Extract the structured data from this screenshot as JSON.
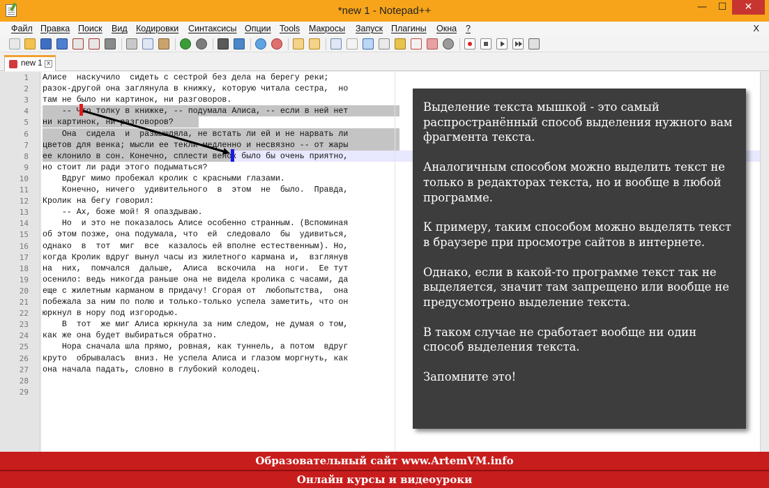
{
  "window": {
    "title": "*new 1 - Notepad++",
    "min_label": "—",
    "max_label": "☐",
    "close_label": "✕"
  },
  "menu": {
    "items": [
      "Файл",
      "Правка",
      "Поиск",
      "Вид",
      "Кодировки",
      "Синтаксисы",
      "Опции",
      "Tools",
      "Макросы",
      "Запуск",
      "Плагины",
      "Окна",
      "?"
    ],
    "close_label": "X"
  },
  "toolbar": {
    "buttons": [
      "new-file-icon",
      "open-file-icon",
      "save-icon",
      "save-all-icon",
      "close-icon",
      "close-all-icon",
      "print-icon",
      "cut-icon",
      "copy-icon",
      "paste-icon",
      "undo-icon",
      "redo-icon",
      "find-icon",
      "replace-icon",
      "zoom-in-icon",
      "zoom-out-icon",
      "sync-v-icon",
      "sync-h-icon",
      "word-wrap-icon",
      "show-all-chars-icon",
      "indent-guide-icon",
      "language-icon",
      "doc-map-icon",
      "function-list-icon",
      "folder-workspace-icon",
      "monitor-icon",
      "record-macro-icon",
      "stop-record-icon",
      "play-macro-icon",
      "run-macro-icon",
      "save-macro-icon"
    ]
  },
  "tab": {
    "name": "new 1",
    "close_label": "x"
  },
  "editor": {
    "lines": [
      "Алисе  наскучило  сидеть с сестрой без дела на берегу реки;",
      "разок-другой она заглянула в книжку, которую читала сестра,  но",
      "там не было ни картинок, ни разговоров.",
      "    -- Что толку в книжке, -- подумала Алиса, -- если в ней нет",
      "ни картинок, ни разговоров?",
      "    Она  сидела  и  размышляла, не встать ли ей и не нарвать ли",
      "цветов для венка; мысли ее текли медленно и несвязно -- от жары",
      "ее клонило в сон. Конечно, сплести венок было бы очень приятно,",
      "но стоит ли ради этого подыматься?",
      "    Вдруг мимо пробежал кролик с красными глазами.",
      "    Конечно, ничего  удивительного  в  этом  не  было.  Правда,",
      "Кролик на бегу говорил:",
      "    -- Ах, боже мой! Я опаздываю.",
      "    Но  и это не показалось Алисе особенно странным. (Вспоминая",
      "об этом позже, она подумала, что  ей  следовало  бы  удивиться,",
      "однако  в  тот  миг  все  казалось ей вполне естественным). Но,",
      "когда Кролик вдруг вынул часы из жилетного кармана и,  взглянув",
      "на  них,  помчался  дальше,  Алиса  вскочила  на  ноги.  Ее тут",
      "осенило: ведь никогда раньше она не видела кролика с часами, да",
      "еще с жилетным карманом в придачу! Сгорая от  любопытства,  она",
      "побежала за ним по полю и только-только успела заметить, что он",
      "юркнул в нору под изгородью.",
      "    В  тот  же миг Алиса юркнула за ним следом, не думая о том,",
      "как же она будет выбираться обратно.",
      "    Нора сначала шла прямо, ровная, как туннель, а потом  вдруг",
      "круто  обрываласъ  вниз. Не успела Алиса и глазом моргнуть, как",
      "она начала падать, словно в глубокий колодец.",
      "",
      ""
    ]
  },
  "info_panel": {
    "paragraphs": [
      "Выделение текста мышкой - это самый распространённый способ выделения нужного вам фрагмента текста.",
      "Аналогичным способом можно выделить текст не только в редакторах текста, но и вообще в любой программе.",
      "К примеру, таким способом можно выделять текст в браузере при просмотре сайтов  в интернете.",
      "Однако, если в какой-то программе текст так не выделяется, значит там запрещено или вообще не предусмотрено выделение текста.",
      "В таком случае не сработает вообще ни один способ выделения текста.",
      "Запомните это!"
    ]
  },
  "banner": {
    "line1": "Образовательный сайт www.ArtemVM.info",
    "line2": "Онлайн курсы и видеоуроки"
  },
  "colors": {
    "titlebar": "#f7a41a",
    "close_button": "#c73530",
    "panel": "#3d3d3d",
    "banner": "#c81d1d",
    "selection": "#c4c4c4",
    "start_marker": "#e21b1b",
    "end_marker": "#1b1be2"
  }
}
